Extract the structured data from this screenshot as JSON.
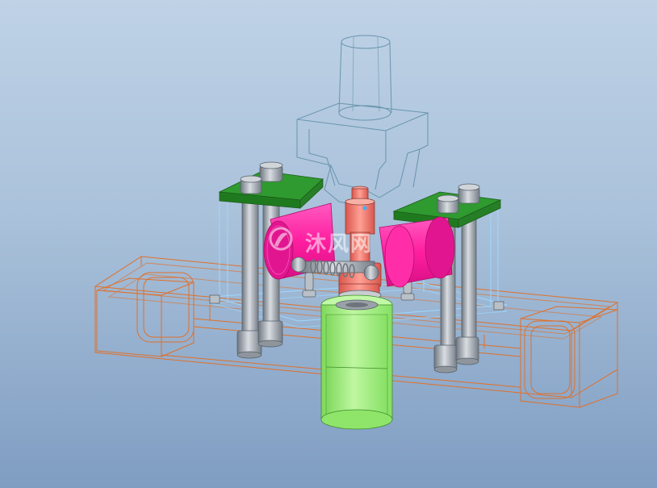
{
  "viewport": {
    "background_top": "#bfd2e6",
    "background_bottom": "#7f9dc2"
  },
  "watermark": {
    "text": "沐风网"
  },
  "colors": {
    "base_wire": "#e0702a",
    "punch_wire": "#5f8fa8",
    "guide_plate": "#2f8f2f",
    "roller": "#ff1fa0",
    "spindle": "#f07f74",
    "cylinder": "#9cf27a",
    "pin": "#a8adb4",
    "guide_frame": "#9ed8ff"
  }
}
